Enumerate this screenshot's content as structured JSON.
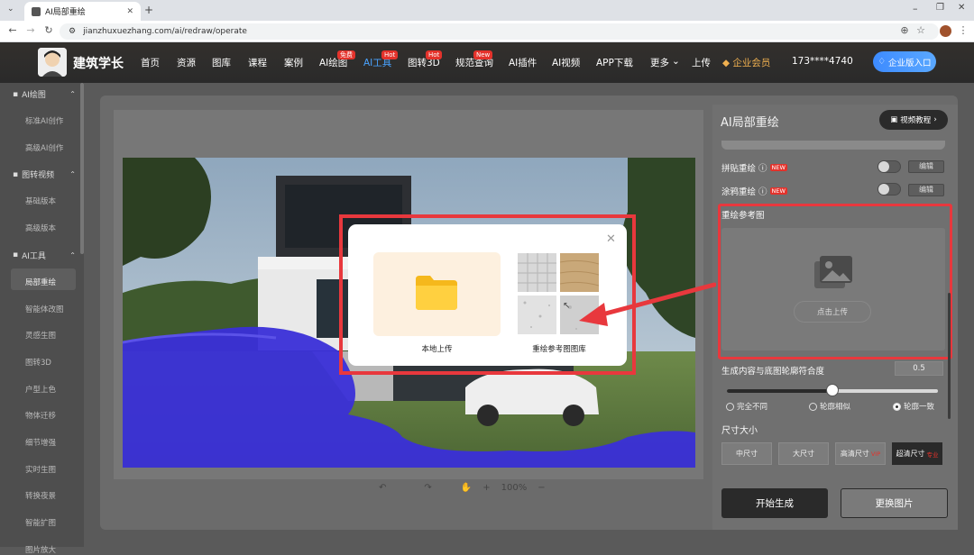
{
  "browser": {
    "tab_title": "AI局部重绘",
    "url": "jianzhuxuezhang.com/ai/redraw/operate",
    "new_tab_glyph": "+"
  },
  "header": {
    "brand": "建筑学长",
    "nav": [
      {
        "label": "首页"
      },
      {
        "label": "资源"
      },
      {
        "label": "图库"
      },
      {
        "label": "课程"
      },
      {
        "label": "案例"
      },
      {
        "label": "AI绘图",
        "badge": "免费"
      },
      {
        "label": "AI工具",
        "badge": "Hot",
        "active": true
      },
      {
        "label": "图转3D",
        "badge": "Hot"
      },
      {
        "label": "规范查询",
        "badge": "New"
      },
      {
        "label": "AI插件"
      },
      {
        "label": "AI视频"
      },
      {
        "label": "APP下载"
      },
      {
        "label": "更多"
      },
      {
        "label": "上传"
      }
    ],
    "member": "企业会员",
    "phone": "173****4740",
    "enterprise": "企业版入口"
  },
  "sidebar": {
    "groups": [
      {
        "label": "AI绘图",
        "items": [
          "标准AI创作",
          "高级AI创作"
        ]
      },
      {
        "label": "图转视频",
        "items": [
          "基础版本",
          "高级版本"
        ]
      },
      {
        "label": "AI工具",
        "items": [
          "局部重绘",
          "智能体改图",
          "灵感生图",
          "图转3D",
          "户型上色",
          "物体迁移",
          "细节增强",
          "实时生图",
          "转换夜景",
          "智能扩图",
          "图片放大"
        ]
      }
    ],
    "active_item": "局部重绘"
  },
  "toolbar": {
    "zoom": "100%"
  },
  "panel": {
    "title": "AI局部重绘",
    "video_btn": "视频教程",
    "rows": [
      {
        "label": "拼贴重绘",
        "badge": "NEW",
        "edit": "编辑"
      },
      {
        "label": "涂鸦重绘",
        "badge": "NEW",
        "edit": "编辑"
      }
    ],
    "ref_title": "重绘参考图",
    "upload_btn": "点击上传",
    "slider_label": "生成内容与底图轮廓符合度",
    "slider_value": "0.5",
    "slider_fraction": 0.5,
    "radios": [
      "完全不同",
      "轮廓相似",
      "轮廓一致"
    ],
    "radio_selected": "轮廓一致",
    "size_label": "尺寸大小",
    "sizes": [
      {
        "label": "中尺寸"
      },
      {
        "label": "大尺寸"
      },
      {
        "label": "高清尺寸",
        "tag": "VIP"
      },
      {
        "label": "超清尺寸",
        "tag": "专业",
        "selected": true
      }
    ],
    "generate": "开始生成",
    "change": "更换图片"
  },
  "modal": {
    "local_label": "本地上传",
    "library_label": "重绘参考图图库"
  },
  "colors": {
    "accent": "#4aa3ff",
    "highlight": "#e8383d",
    "mask": "#3a2fd8"
  }
}
